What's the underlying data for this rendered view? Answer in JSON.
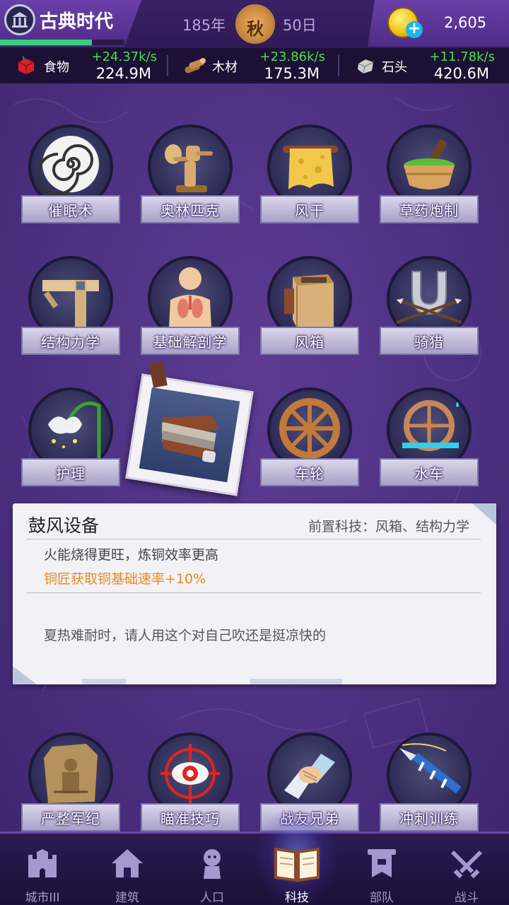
{
  "header": {
    "era_name": "古典时代",
    "era_progress": 0.74,
    "year": "185年",
    "season": "秋",
    "day": "50日",
    "gold": "2,605"
  },
  "resources": [
    {
      "name": "食物",
      "rate": "+24.37k/s",
      "amount": "224.9M",
      "icon": "food-crate-icon"
    },
    {
      "name": "木材",
      "rate": "+23.86k/s",
      "amount": "175.3M",
      "icon": "wood-logs-icon"
    },
    {
      "name": "石头",
      "rate": "+11.78k/s",
      "amount": "420.6M",
      "icon": "stone-block-icon"
    }
  ],
  "techs": [
    {
      "label": "催眠术",
      "icon": "spiral-icon"
    },
    {
      "label": "奥林匹克",
      "icon": "discus-statue-icon"
    },
    {
      "label": "风干",
      "icon": "drying-cloth-icon"
    },
    {
      "label": "草药炮制",
      "icon": "mortar-pestle-icon"
    },
    {
      "label": "结构力学",
      "icon": "beam-structure-icon"
    },
    {
      "label": "基础解剖学",
      "icon": "anatomy-icon"
    },
    {
      "label": "风箱",
      "icon": "bellows-box-icon"
    },
    {
      "label": "骑猎",
      "icon": "horseshoe-arrows-icon"
    },
    {
      "label": "护理",
      "icon": "lily-flower-icon"
    },
    {
      "label": "车轮",
      "icon": "wheel-icon"
    },
    {
      "label": "水车",
      "icon": "waterwheel-icon"
    },
    {
      "label": "严整军纪",
      "icon": "stone-tablet-icon"
    },
    {
      "label": "瞄准技巧",
      "icon": "target-eye-icon"
    },
    {
      "label": "战友兄弟",
      "icon": "handshake-icon"
    },
    {
      "label": "冲刺训练",
      "icon": "lance-icon"
    }
  ],
  "detail": {
    "title": "鼓风设备",
    "prereq": "前置科技：风箱、结构力学",
    "desc": "火能烧得更旺，炼铜效率更高",
    "effect": "铜匠获取铜基础速率+10%",
    "flavor": "夏热难耐时，请人用这个对自己吹还是挺凉快的"
  },
  "nav": [
    {
      "label": "城市III",
      "icon": "castle-icon"
    },
    {
      "label": "建筑",
      "icon": "house-icon"
    },
    {
      "label": "人口",
      "icon": "person-icon"
    },
    {
      "label": "科技",
      "icon": "book-icon",
      "active": true
    },
    {
      "label": "部队",
      "icon": "banner-icon"
    },
    {
      "label": "战斗",
      "icon": "crossed-swords-icon"
    }
  ],
  "colors": {
    "rate_green": "#42e34a",
    "effect_orange": "#e88a1e",
    "bg_purple": "#4d3182"
  }
}
